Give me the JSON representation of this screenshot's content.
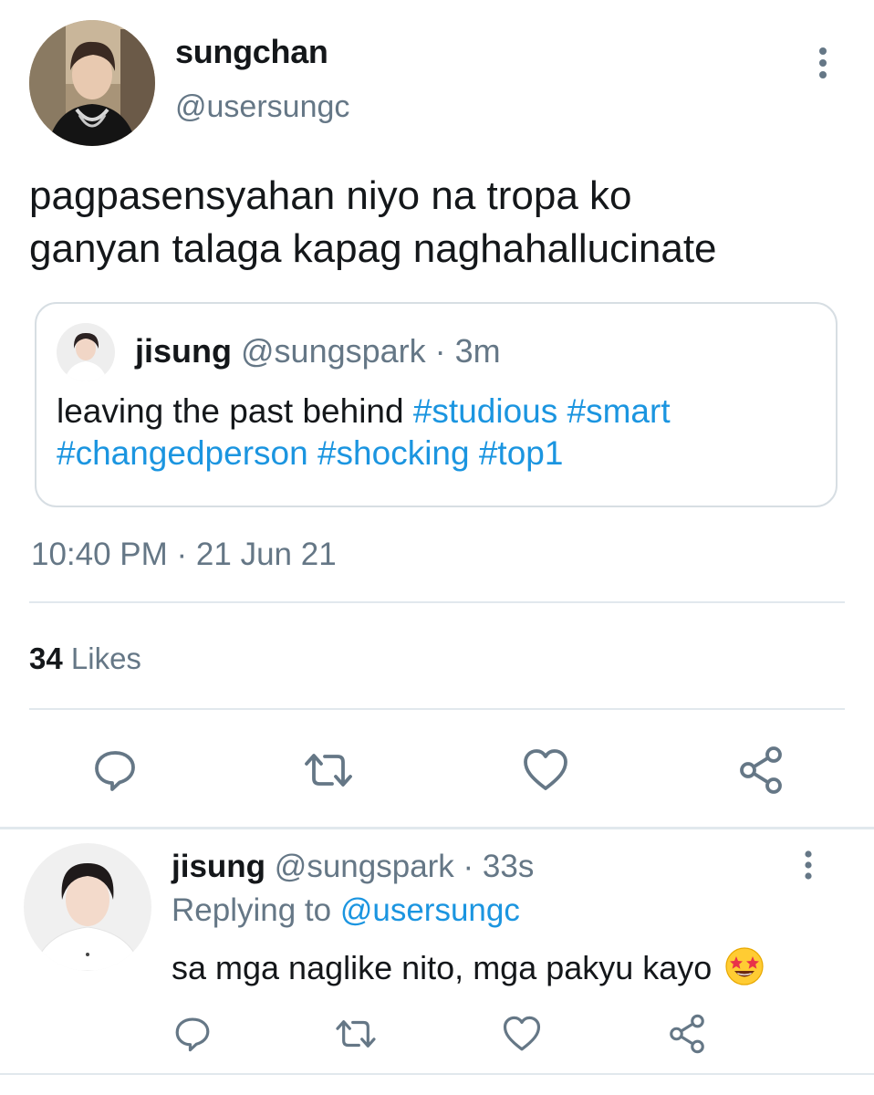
{
  "main_tweet": {
    "display_name": "sungchan",
    "handle": "@usersungc",
    "text_lines": [
      "pagpasensyahan niyo na tropa ko",
      "ganyan talaga kapag naghahallucinate"
    ],
    "timestamp": "10:40 PM · 21 Jun 21",
    "likes_count": "34",
    "likes_label": "Likes"
  },
  "quoted_tweet": {
    "display_name": "jisung",
    "handle_time": "@sungspark · 3m",
    "text_plain": "leaving the past behind ",
    "hashtags_line1": [
      "#studious",
      "#smart"
    ],
    "hashtags_line2": [
      "#changedperson",
      "#shocking",
      "#top1"
    ]
  },
  "reply": {
    "display_name": "jisung",
    "handle_time": "@sungspark · 33s",
    "replying_prefix": "Replying to ",
    "replying_to": "@usersungc",
    "text": "sa mga naglike nito, mga pakyu kayo",
    "emoji": "star-struck-emoji"
  },
  "icons": {
    "reply": "reply-icon",
    "retweet": "retweet-icon",
    "like": "like-icon",
    "share": "share-icon",
    "more": "more-vertical-icon"
  },
  "colors": {
    "text": "#14171a",
    "secondary": "#657786",
    "link": "#1b95e0",
    "divider": "#e1e8ed"
  }
}
